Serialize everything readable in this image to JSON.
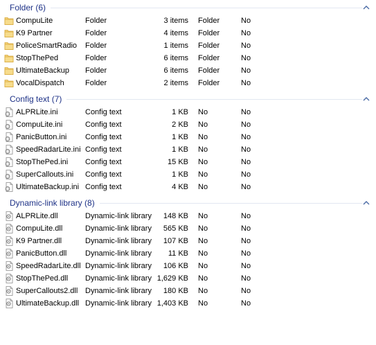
{
  "groups": {
    "folders": {
      "title": "Folder (6)",
      "rows": [
        {
          "name": "CompuLite",
          "type": "Folder",
          "size": "3 items",
          "col1": "Folder",
          "col2": "No"
        },
        {
          "name": "K9 Partner",
          "type": "Folder",
          "size": "4 items",
          "col1": "Folder",
          "col2": "No"
        },
        {
          "name": "PoliceSmartRadio",
          "type": "Folder",
          "size": "1 items",
          "col1": "Folder",
          "col2": "No"
        },
        {
          "name": "StopThePed",
          "type": "Folder",
          "size": "6 items",
          "col1": "Folder",
          "col2": "No"
        },
        {
          "name": "UltimateBackup",
          "type": "Folder",
          "size": "6 items",
          "col1": "Folder",
          "col2": "No"
        },
        {
          "name": "VocalDispatch",
          "type": "Folder",
          "size": "2 items",
          "col1": "Folder",
          "col2": "No"
        }
      ]
    },
    "config": {
      "title": "Config text (7)",
      "rows": [
        {
          "name": "ALPRLite.ini",
          "type": "Config text",
          "size": "1 KB",
          "col1": "No",
          "col2": "No"
        },
        {
          "name": "CompuLite.ini",
          "type": "Config text",
          "size": "2 KB",
          "col1": "No",
          "col2": "No"
        },
        {
          "name": "PanicButton.ini",
          "type": "Config text",
          "size": "1 KB",
          "col1": "No",
          "col2": "No"
        },
        {
          "name": "SpeedRadarLite.ini",
          "type": "Config text",
          "size": "1 KB",
          "col1": "No",
          "col2": "No"
        },
        {
          "name": "StopThePed.ini",
          "type": "Config text",
          "size": "15 KB",
          "col1": "No",
          "col2": "No"
        },
        {
          "name": "SuperCallouts.ini",
          "type": "Config text",
          "size": "1 KB",
          "col1": "No",
          "col2": "No"
        },
        {
          "name": "UltimateBackup.ini",
          "type": "Config text",
          "size": "4 KB",
          "col1": "No",
          "col2": "No"
        }
      ]
    },
    "dll": {
      "title": "Dynamic-link library (8)",
      "rows": [
        {
          "name": "ALPRLite.dll",
          "type": "Dynamic-link library",
          "size": "148 KB",
          "col1": "No",
          "col2": "No"
        },
        {
          "name": "CompuLite.dll",
          "type": "Dynamic-link library",
          "size": "565 KB",
          "col1": "No",
          "col2": "No"
        },
        {
          "name": "K9 Partner.dll",
          "type": "Dynamic-link library",
          "size": "107 KB",
          "col1": "No",
          "col2": "No"
        },
        {
          "name": "PanicButton.dll",
          "type": "Dynamic-link library",
          "size": "11 KB",
          "col1": "No",
          "col2": "No"
        },
        {
          "name": "SpeedRadarLite.dll",
          "type": "Dynamic-link library",
          "size": "106 KB",
          "col1": "No",
          "col2": "No"
        },
        {
          "name": "StopThePed.dll",
          "type": "Dynamic-link library",
          "size": "1,629 KB",
          "col1": "No",
          "col2": "No"
        },
        {
          "name": "SuperCallouts2.dll",
          "type": "Dynamic-link library",
          "size": "180 KB",
          "col1": "No",
          "col2": "No"
        },
        {
          "name": "UltimateBackup.dll",
          "type": "Dynamic-link library",
          "size": "1,403 KB",
          "col1": "No",
          "col2": "No"
        }
      ]
    }
  },
  "icons": {
    "group_collapse": "chevron-up-icon",
    "folder": "folder-icon",
    "config": "config-file-icon",
    "dll": "dll-file-icon"
  },
  "colors": {
    "group_title": "#1e3287",
    "group_line": "#e2e7f1",
    "folder_fill": "#f3d27a",
    "folder_edge": "#d9a93b"
  }
}
